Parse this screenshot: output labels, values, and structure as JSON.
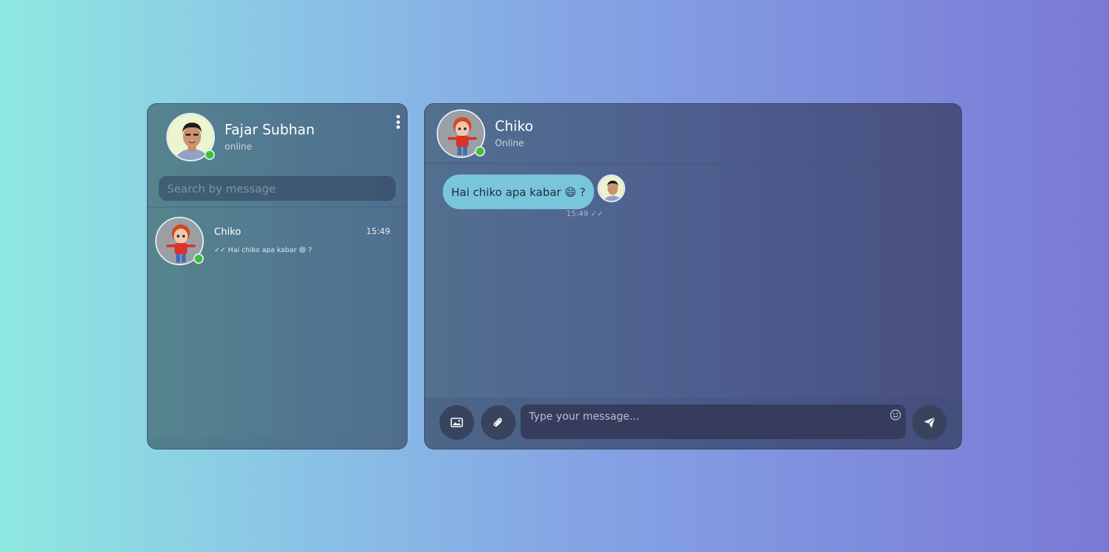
{
  "sidebar": {
    "user": {
      "name": "Fajar Subhan",
      "status": "online"
    },
    "search": {
      "placeholder": "Search by message"
    },
    "chats": [
      {
        "name": "Chiko",
        "time": "15:49",
        "preview": "✓✓ Hai chiko apa kabar 😄 ?"
      }
    ]
  },
  "chat": {
    "contact": {
      "name": "Chiko",
      "status": "Online"
    },
    "messages": [
      {
        "text": "Hai chiko apa kabar 😄 ?",
        "meta": "15:49 ✓✓"
      }
    ],
    "input": {
      "placeholder": "Type your message..."
    }
  },
  "colors": {
    "online_dot": "#39c23a",
    "bubble": "#79c6db",
    "button_bg": "#38445e"
  },
  "icons": [
    "kebab-menu-icon",
    "image-icon",
    "paperclip-icon",
    "emoji-icon",
    "send-icon"
  ]
}
